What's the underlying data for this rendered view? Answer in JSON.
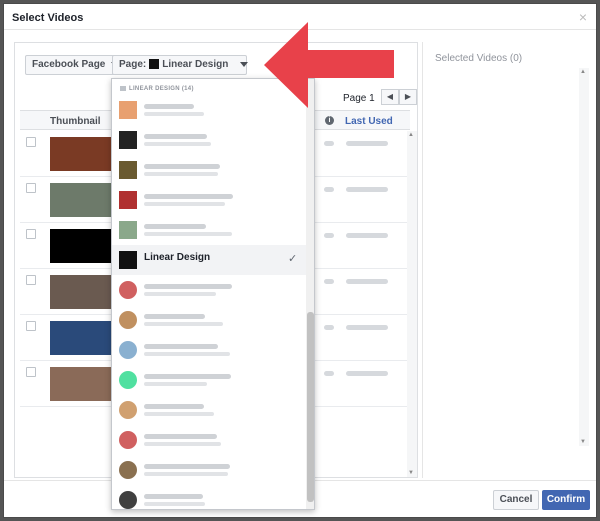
{
  "dialog": {
    "title": "Select Videos",
    "close_glyph": "×"
  },
  "toolbar": {
    "source_label": "Facebook Page",
    "page_prefix": "Page:",
    "page_name": "Linear Design"
  },
  "pagination": {
    "label": "Page 1",
    "prev_glyph": "◀",
    "next_glyph": "▶"
  },
  "table": {
    "columns": {
      "thumbnail": "Thumbnail",
      "last_used": "Last Used"
    },
    "info_glyph": "i"
  },
  "thumb_colors": [
    "#7a3a24",
    "#6d7a6a",
    "#000000",
    "#6a5a50",
    "#2a4a7a",
    "#8a6a58"
  ],
  "dropdown": {
    "header": "LINEAR DESIGN (14)",
    "selected_label": "Linear Design",
    "check_glyph": "✓",
    "avatar_colors": [
      "#e8a070",
      "#222222",
      "#6a5a30",
      "#b03030",
      "#8aa88a",
      "#111111",
      "#d06060",
      "#c09060",
      "#8ab0d0",
      "#50e0a0",
      "#d0a070",
      "#d06060",
      "#8a7050",
      "#404040"
    ]
  },
  "selected_panel": {
    "title": "Selected Videos (0)"
  },
  "actions": {
    "cancel": "Cancel",
    "confirm": "Confirm"
  }
}
